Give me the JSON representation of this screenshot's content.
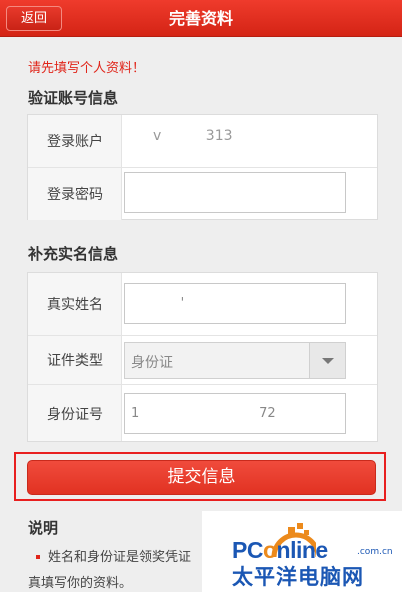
{
  "header": {
    "back_label": "返回",
    "title": "完善资料"
  },
  "hint": "请先填写个人资料！",
  "account_section": {
    "title": "验证账号信息",
    "login_account_label": "登录账户",
    "login_account_value": "v          313",
    "password_label": "登录密码",
    "password_value": ""
  },
  "identity_section": {
    "title": "补充实名信息",
    "real_name_label": "真实姓名",
    "real_name_value": "            '",
    "id_type_label": "证件类型",
    "id_type_value": "身份证",
    "id_number_label": "身份证号",
    "id_number_value": "1                             72"
  },
  "submit_label": "提交信息",
  "notes": {
    "title": "说明",
    "line1": "姓名和身份证是领奖凭证",
    "line2": "真填写你的资料。"
  },
  "watermark": {
    "brand_prefix": "PC",
    "brand_o": "o",
    "brand_suffix": "nline",
    "domain": ".com.cn",
    "chinese": "太平洋电脑网"
  },
  "colors": {
    "header_red": "#d42415",
    "hint_red": "#e0251a",
    "highlight_frame": "#e81f1f",
    "watermark_blue": "#1b57b4",
    "watermark_orange": "#ec8a1c"
  }
}
